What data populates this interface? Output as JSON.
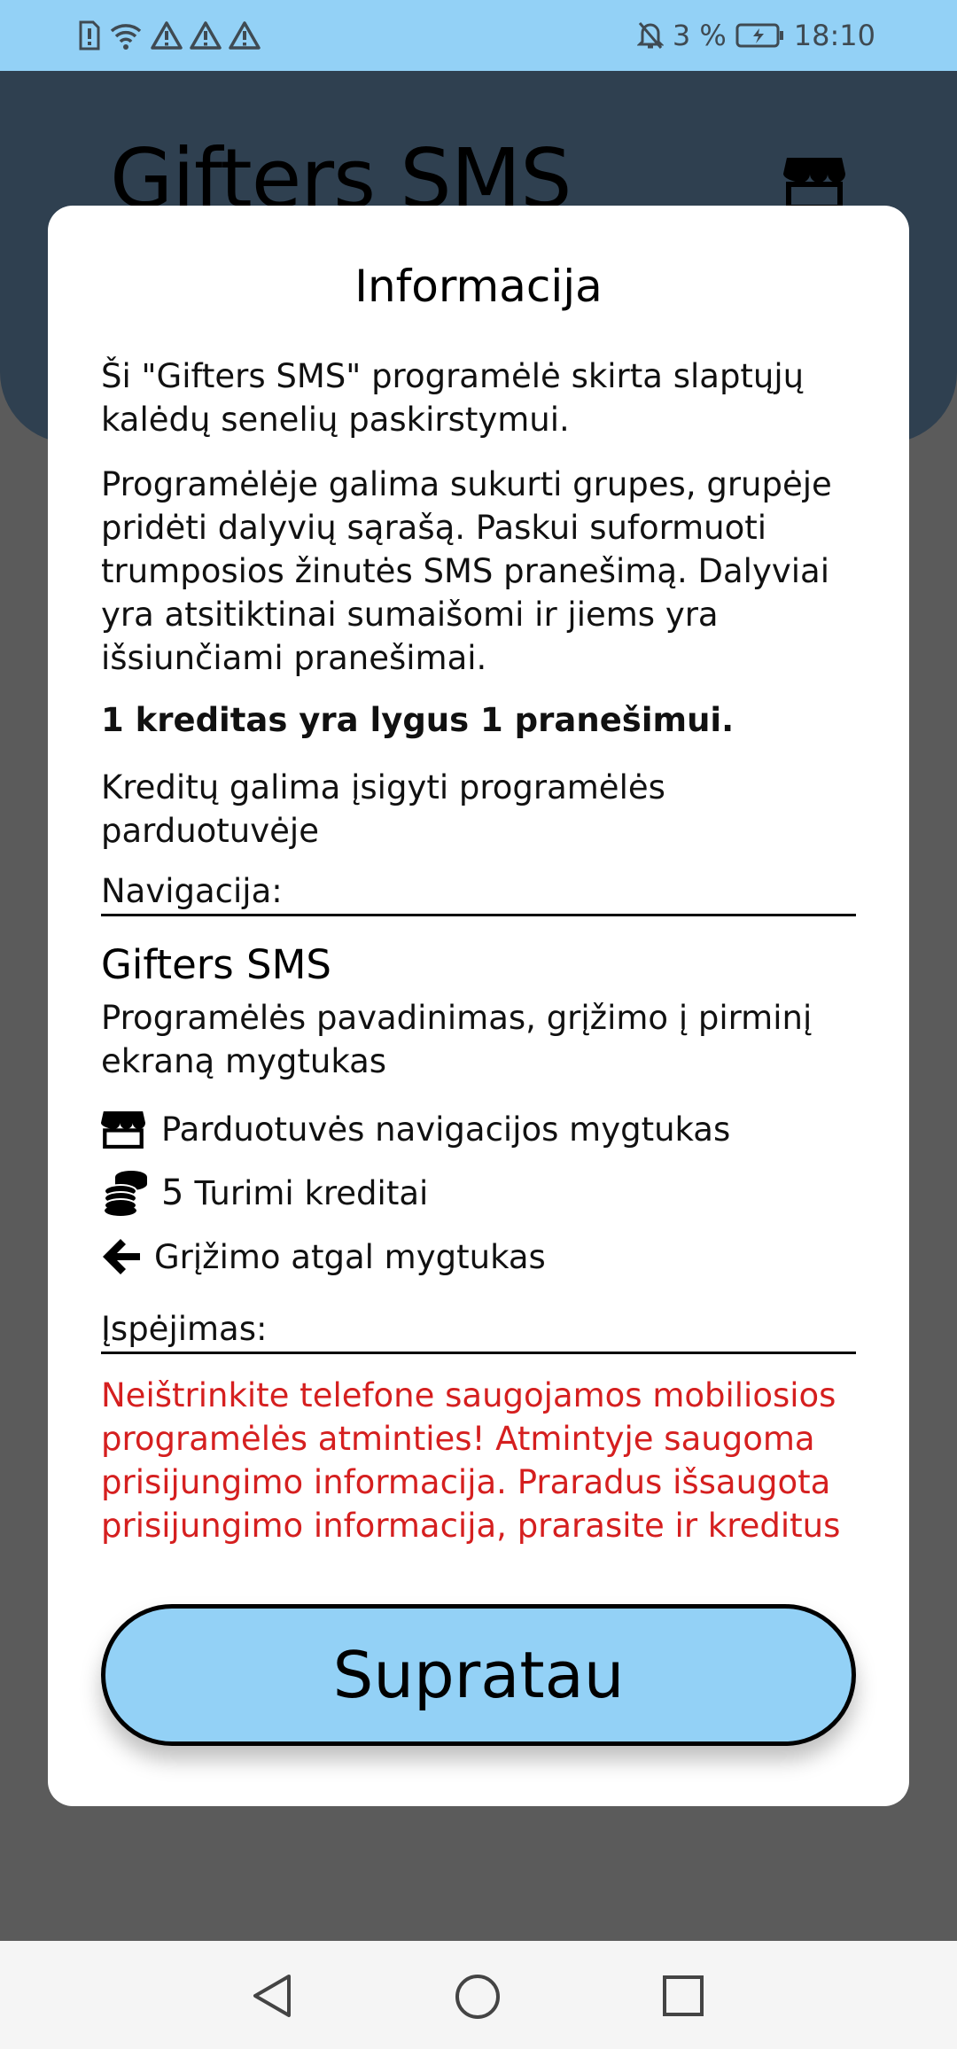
{
  "status_bar": {
    "battery": "3 %",
    "time": "18:10"
  },
  "app": {
    "title": "Gifters SMS"
  },
  "dialog": {
    "title": "Informacija",
    "para1": "Ši \"Gifters SMS\" programėlė skirta slaptųjų kalėdų senelių paskirstymui.",
    "para2": "Programėlėje galima sukurti grupes, grupėje pridėti dalyvių sąrašą. Paskui suformuoti trumposios žinutės SMS pranešimą. Dalyviai yra atsitiktinai sumaišomi ir jiems yra išsiunčiami pranešimai.",
    "para3": "1 kreditas yra lygus 1 pranešimui.",
    "para4": "Kreditų galima įsigyti programėlės parduotuvėje",
    "nav_label": "Navigacija:",
    "nav_app_name": "Gifters SMS",
    "nav_app_desc": "Programėlės pavadinimas, grįžimo į pirminį ekraną mygtukas",
    "nav_store": "Parduotuvės navigacijos mygtukas",
    "credit_count": "5",
    "nav_credits": "Turimi kreditai",
    "nav_back": "Grįžimo atgal mygtukas",
    "warning_label": "Įspėjimas:",
    "warning_text": "Neištrinkite telefone saugojamos mobiliosios programėlės atminties! Atmintyje saugoma prisijungimo informacija. Praradus išsaugota prisijungimo informacija, prarasite ir kreditus",
    "ok_button": "Supratau"
  },
  "colors": {
    "accent": "#93d1f6",
    "warning": "#d51f1f",
    "header": "#2f4050"
  },
  "icons": [
    "store-icon",
    "coins-icon",
    "arrow-left-icon",
    "nav-back-icon",
    "nav-home-icon",
    "nav-recents-icon"
  ]
}
